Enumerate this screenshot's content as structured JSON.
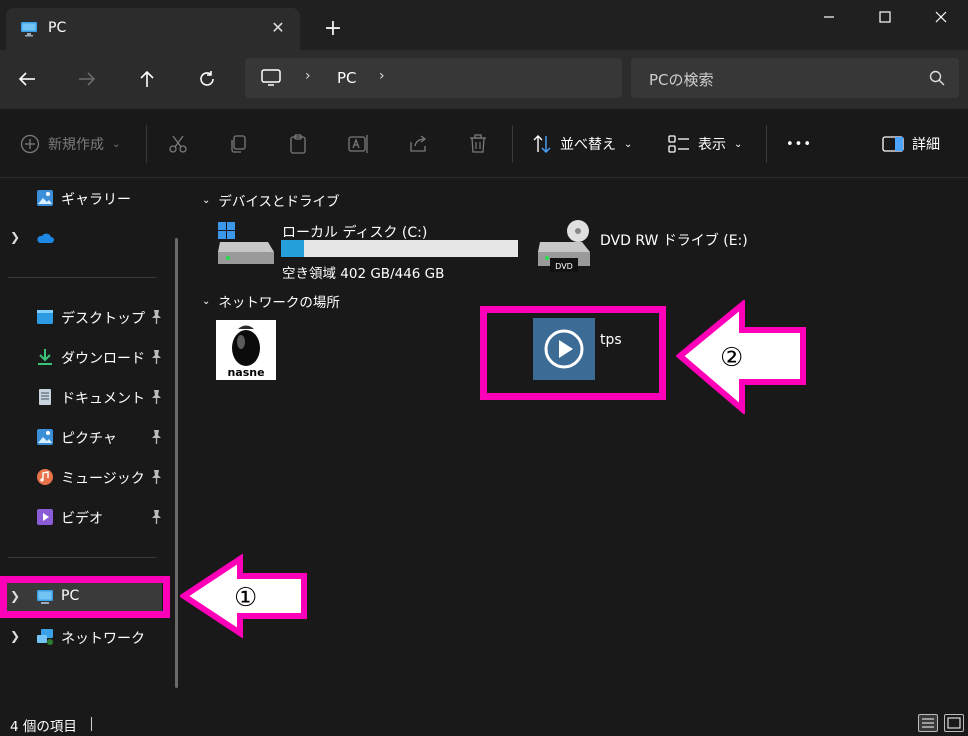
{
  "tab": {
    "title": "PC",
    "close_glyph": "✕",
    "new_tab_glyph": "+"
  },
  "window_controls": {
    "minimize": "minimize-icon",
    "maximize": "maximize-icon",
    "close": "close-icon"
  },
  "address": {
    "crumb": "PC",
    "separator": "›"
  },
  "search": {
    "placeholder": "PCの検索"
  },
  "toolbar": {
    "new_label": "新規作成",
    "sort_label": "並べ替え",
    "view_label": "表示",
    "more_glyph": "•••",
    "details_label": "詳細"
  },
  "sidebar": {
    "gallery": "ギャラリー",
    "desktop": "デスクトップ",
    "downloads": "ダウンロード",
    "documents": "ドキュメント",
    "pictures": "ピクチャ",
    "music": "ミュージック",
    "videos": "ビデオ",
    "pc": "PC",
    "network": "ネットワーク"
  },
  "main": {
    "devices_header": "デバイスとドライブ",
    "network_header": "ネットワークの場所",
    "drive_c": {
      "name": "ローカル ディスク (C:)",
      "free_text": "空き領域 402 GB/446 GB",
      "used_fraction": 0.099
    },
    "drive_e": {
      "name": "DVD RW ドライブ (E:)",
      "badge": "DVD"
    },
    "nasne": {
      "logo_text": "nasne"
    },
    "tps": {
      "name": "tps"
    }
  },
  "annotations": {
    "marker1": "①",
    "marker2": "②",
    "color": "#ff00b8"
  },
  "statusbar": {
    "item_count": "4 個の項目"
  },
  "colors": {
    "accent": "#26a0da",
    "background": "#191919",
    "chrome": "#2c2c2c"
  }
}
